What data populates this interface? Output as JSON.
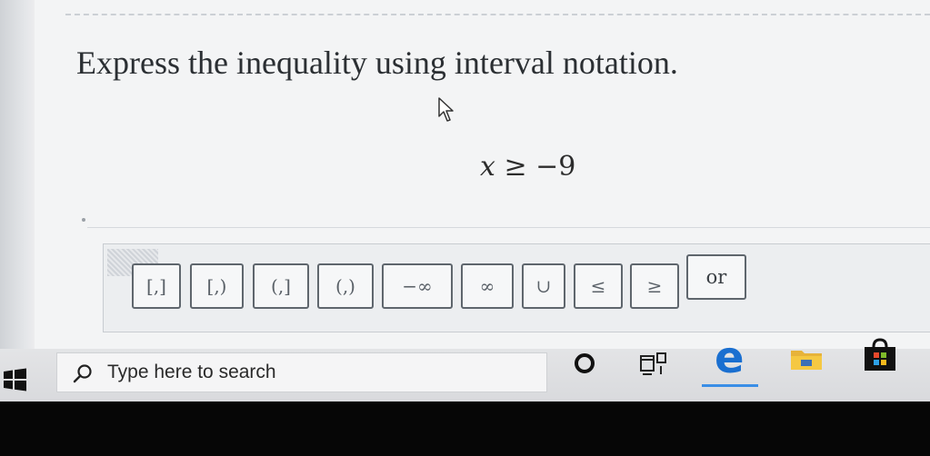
{
  "question": {
    "prompt": "Express the inequality using interval notation.",
    "expression": {
      "variable": "x",
      "operator": "≥",
      "value": "−9"
    }
  },
  "palette": {
    "buttons": [
      {
        "label": "[,]"
      },
      {
        "label": "[,)"
      },
      {
        "label": "(,]"
      },
      {
        "label": "(,)"
      },
      {
        "label": "−∞"
      },
      {
        "label": "∞"
      },
      {
        "label": "∪"
      },
      {
        "label": "≤"
      },
      {
        "label": "≥"
      },
      {
        "label": "or"
      }
    ]
  },
  "taskbar": {
    "search_placeholder": "Type here to search",
    "icons": [
      "windows-start-icon",
      "search-icon",
      "cortana-icon",
      "task-view-icon",
      "edge-icon",
      "file-explorer-icon",
      "store-icon"
    ],
    "edge_glyph": "e"
  },
  "colors": {
    "edge_blue": "#1a6fd0",
    "palette_border": "#5f666d",
    "question_text": "#2b2f33"
  }
}
